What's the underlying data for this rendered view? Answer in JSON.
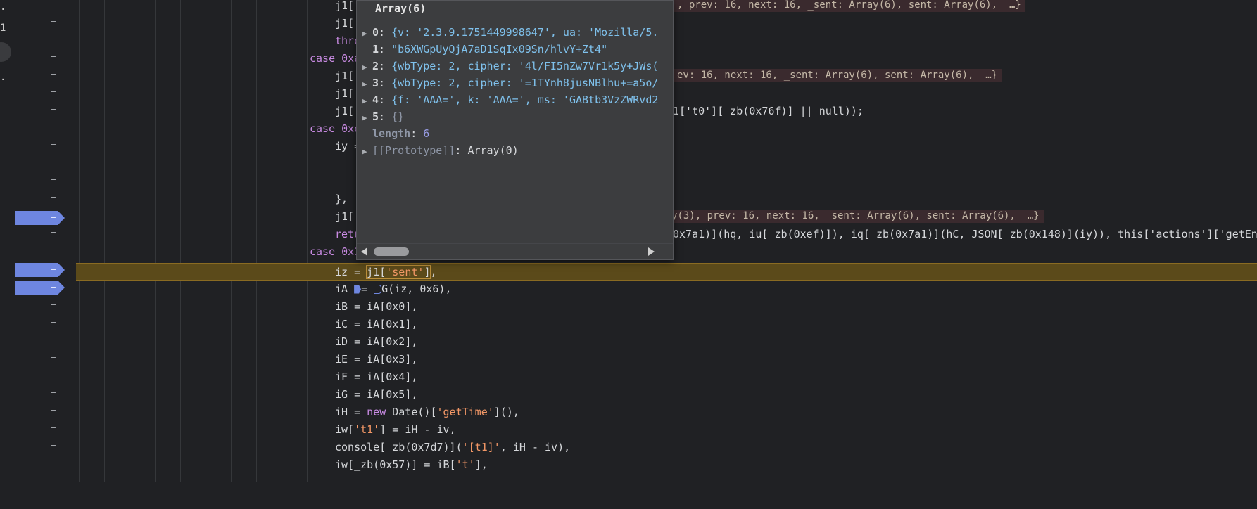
{
  "gutter": {
    "marks": [
      ".",
      "1",
      "."
    ],
    "dash": "–"
  },
  "popover": {
    "title": "Array(6)",
    "rows": [
      {
        "key": "0",
        "preview": "{v: '2.3.9.1751449998647', ua: 'Mozilla/5."
      },
      {
        "key": "1",
        "preview": "\"b6XWGpUyQjA7aD1SqIx09Sn/hlvY+Zt4\""
      },
      {
        "key": "2",
        "preview": "{wbType: 2, cipher: '4l/FI5nZw7Vr1k5y+JWs("
      },
      {
        "key": "3",
        "preview": "{wbType: 2, cipher: '=1TYnh8jusNBlhu+=a5o/"
      },
      {
        "key": "4",
        "preview": "{f: 'AAA=', k: 'AAA=', ms: 'GABtb3VzZWRvd2"
      },
      {
        "key": "5",
        "preview": "{}"
      },
      {
        "key": "length",
        "preview": "6"
      },
      {
        "key": "[[Prototype]]",
        "preview": "Array(0)"
      }
    ]
  },
  "code": {
    "lines": [
      {
        "text_left": "j1[",
        "inline": ", prev: 16, next: 16, _sent: Array(6), sent: Array(6),  …}"
      },
      {
        "text_left": "j1[",
        "inline": ""
      },
      {
        "text_left": "thro",
        "inline": ""
      },
      {
        "text_left": "case 0xa",
        "inline": ""
      },
      {
        "text_left": "j1['",
        "inline": "ev: 16, next: 16, _sent: Array(6), sent: Array(6),  …}"
      },
      {
        "text_left": "j1[",
        "inline": ""
      },
      {
        "text_left": "j1['",
        "right": "1['t0'][_zb(0x76f)] || null));"
      },
      {
        "text_left": "case 0xd",
        "inline": ""
      },
      {
        "text_left": "iy =",
        "inline": ""
      },
      {
        "text_left": "",
        "inline": ""
      },
      {
        "text_left": "",
        "inline": ""
      },
      {
        "text_left": "},",
        "inline": ""
      },
      {
        "text_left": "j1[",
        "inline": "y(3), prev: 16, next: 16, _sent: Array(6), sent: Array(6),  …}"
      },
      {
        "text_left": "retu",
        "right": "0x7a1)](hq, iu[_zb(0xef)]), iq[_zb(0x7a1)](hC, JSON[_zb(0x148)](iy)), this['actions']['getEnc"
      },
      {
        "text_left": "case 0x1",
        "inline": ""
      },
      {
        "text": "iz = j1['sent'],"
      },
      {
        "text": "iA = G(iz, 0x6),"
      },
      {
        "text": "iB = iA[0x0],"
      },
      {
        "text": "iC = iA[0x1],"
      },
      {
        "text": "iD = iA[0x2],"
      },
      {
        "text": "iE = iA[0x3],"
      },
      {
        "text": "iF = iA[0x4],"
      },
      {
        "text": "iG = iA[0x5],"
      },
      {
        "text": "iH = new Date()['getTime'](),"
      },
      {
        "text": "iw['t1'] = iH - iv,"
      },
      {
        "text": "console[_zb(0x7d7)]('[t1]', iH - iv),"
      },
      {
        "text": "iw[_zb(0x57)] = iB['t'],"
      }
    ]
  },
  "colors": {
    "background": "#202124",
    "breakpoint": "#6e86e0",
    "current_line": "#5b4a1a",
    "keyword": "#c98be3",
    "string": "#f29766",
    "popover_bg": "#3c3d3f"
  }
}
